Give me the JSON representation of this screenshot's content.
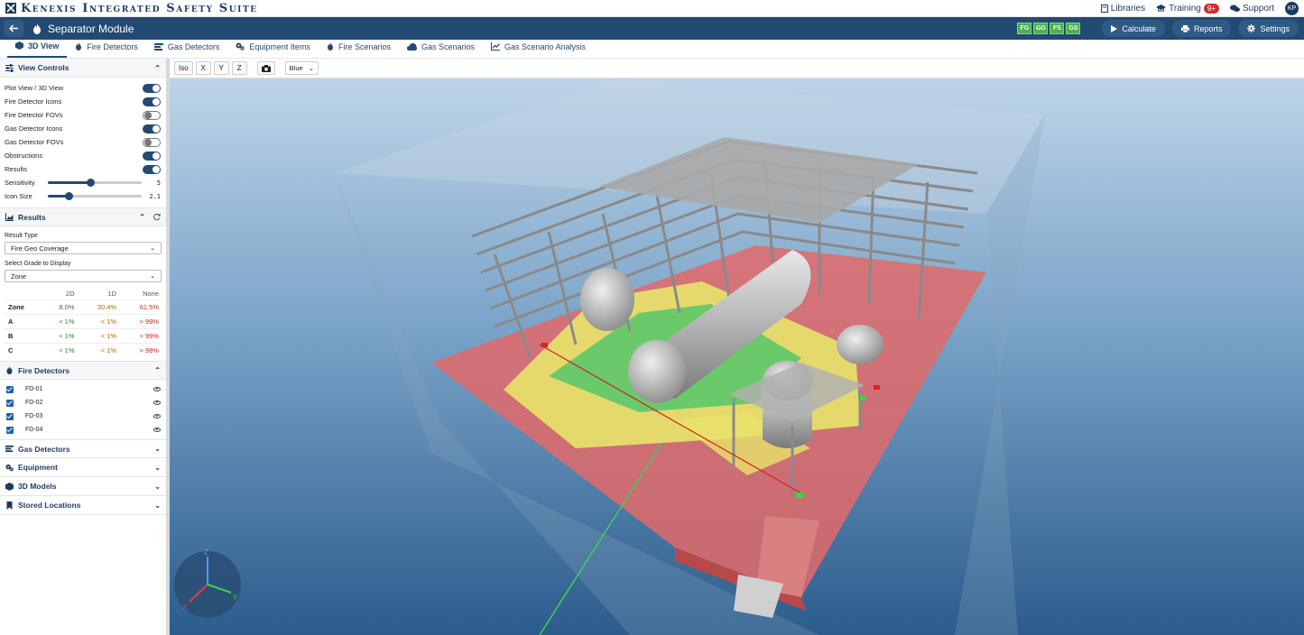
{
  "app": {
    "title": "Kenexis Integrated Safety Suite"
  },
  "top_links": {
    "libraries": "Libraries",
    "training": "Training",
    "training_badge": "9+",
    "support": "Support",
    "avatar": "KP"
  },
  "module": {
    "title": "Separator Module",
    "tags": [
      "FG",
      "GG",
      "FS",
      "GS"
    ],
    "calculate": "Calculate",
    "reports": "Reports",
    "settings": "Settings"
  },
  "tabs": [
    {
      "label": "3D View",
      "icon": "cube-icon"
    },
    {
      "label": "Fire Detectors",
      "icon": "flame-icon"
    },
    {
      "label": "Gas Detectors",
      "icon": "gas-detector-icon"
    },
    {
      "label": "Equipment Items",
      "icon": "gear-icon"
    },
    {
      "label": "Fire Scenarios",
      "icon": "flame-icon"
    },
    {
      "label": "Gas Scenarios",
      "icon": "cloud-icon"
    },
    {
      "label": "Gas Scenario Analysis",
      "icon": "chart-line-icon"
    }
  ],
  "view_controls": {
    "title": "View Controls",
    "toggles": [
      {
        "label": "Plot View / 3D View",
        "on": true
      },
      {
        "label": "Fire Detector Icons",
        "on": true
      },
      {
        "label": "Fire Detector FOVs",
        "on": false
      },
      {
        "label": "Gas Detector Icons",
        "on": true
      },
      {
        "label": "Gas Detector FOVs",
        "on": false
      },
      {
        "label": "Obstructions",
        "on": true
      },
      {
        "label": "Results",
        "on": true
      }
    ],
    "sliders": [
      {
        "label": "Sensitivity",
        "value": "5",
        "fraction": 0.45
      },
      {
        "label": "Icon Size",
        "value": "2.1",
        "fraction": 0.22
      }
    ]
  },
  "results": {
    "title": "Results",
    "result_type_label": "Result Type",
    "result_type_value": "Fire Geo Coverage",
    "grade_label": "Select Grade to Display",
    "grade_value": "Zone",
    "columns": [
      "",
      "2D",
      "1D",
      "None"
    ],
    "rows": [
      {
        "name": "Zone",
        "c2d": "8.0%",
        "c1d": "30.4%",
        "none": "61.5%"
      },
      {
        "name": "A",
        "c2d": "< 1%",
        "c1d": "< 1%",
        "none": "> 99%"
      },
      {
        "name": "B",
        "c2d": "< 1%",
        "c1d": "< 1%",
        "none": "> 99%"
      },
      {
        "name": "C",
        "c2d": "< 1%",
        "c1d": "< 1%",
        "none": "> 99%"
      }
    ]
  },
  "fire_detectors": {
    "title": "Fire Detectors",
    "items": [
      "FD-01",
      "FD-02",
      "FD-03",
      "FD-04"
    ]
  },
  "collapsed_panels": {
    "gas_detectors": "Gas Detectors",
    "equipment": "Equipment",
    "models": "3D Models",
    "stored": "Stored Locations"
  },
  "view_toolbar": {
    "iso": "Iso",
    "x": "X",
    "y": "Y",
    "z": "Z",
    "color": "Blue"
  },
  "axes": {
    "x": "X",
    "y": "Y",
    "z": "Z"
  },
  "colors": {
    "primary": "#234a72",
    "accent_green": "#4caf50",
    "sky_top": "#bcd3e6",
    "sky_bottom": "#2c5e8e"
  }
}
